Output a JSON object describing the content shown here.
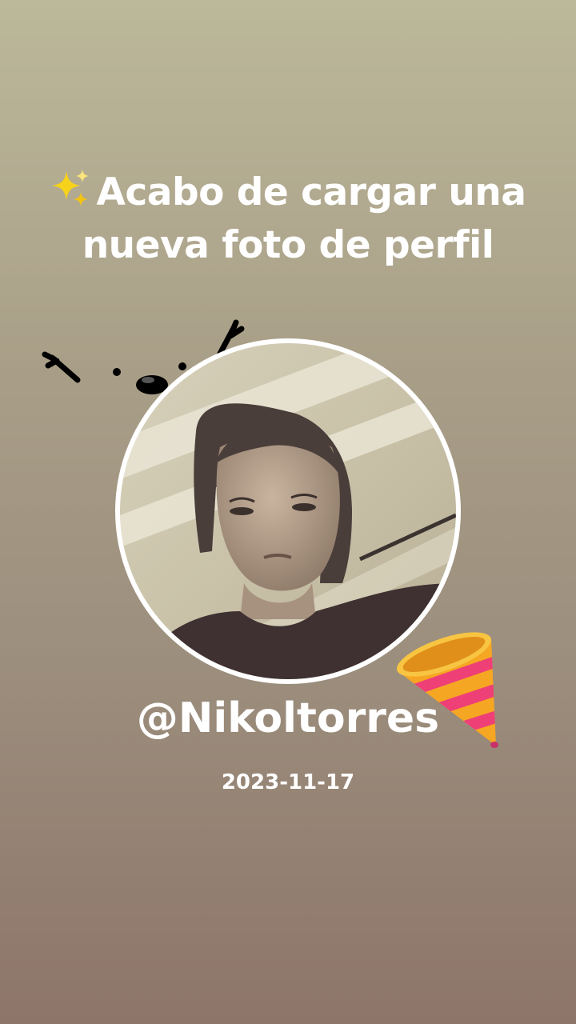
{
  "post": {
    "headline": "Acabo de cargar una nueva foto de perfil",
    "username": "@Nikoltorres",
    "date": "2023-11-17"
  },
  "icons": {
    "headline_icon": "sparkles-icon",
    "decoration_top": "face-doodle-icon",
    "decoration_bottom": "party-popper-icon"
  },
  "colors": {
    "background_top": "#bcb89a",
    "background_bottom": "#8d7569",
    "text": "#ffffff",
    "sparkle": "#f7d21a"
  }
}
